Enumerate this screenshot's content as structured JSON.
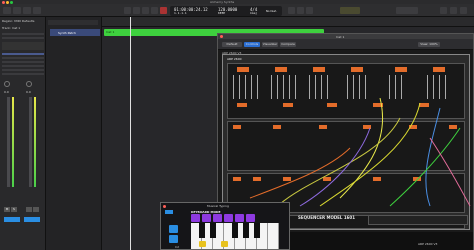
{
  "window": {
    "title": "Alchemy Synths"
  },
  "transport": {
    "position": "1.1.1.1",
    "bars": "01:00:00:24.12",
    "tempo": "120.0000",
    "tempo_label": "KEEP",
    "signature": "4/4",
    "key": "Cmaj",
    "bpm_mode": "Normal"
  },
  "inspector": {
    "region_label": "Region: MIDI Defaults",
    "track_label": "Track: Inst 1",
    "channel_strip": "Setting",
    "eq_label": "EQ",
    "plugin_slot": "Alchemy",
    "send_label": "Sends",
    "output": "Stereo Out",
    "group": "Group",
    "automation": "Read",
    "volume": "0.0",
    "volume2": "0.0",
    "mute": "M",
    "solo": "S"
  },
  "track": {
    "name": "Synth Patch",
    "region_name": "Inst 1"
  },
  "plugin": {
    "title": "Inst 1",
    "preset": "Default",
    "tab_controls": "Controls",
    "tab_view": "Visualizer",
    "compare": "Compare",
    "view_label": "View: 100%",
    "model_name": "ARP 2600 V3",
    "synth_logo": "ARP 2600",
    "sequencer_label": "SEQUENCER MODEL 1601",
    "arp_label": "ARP 2600 V3"
  },
  "keyboard": {
    "title": "Musical Typing",
    "mode": "KEYBOARD MODE",
    "octave": "C2"
  },
  "colors": {
    "region_green": "#3ed13e",
    "accent_orange": "#e36c2a",
    "pad_purple": "#8e3ae0",
    "pad_yellow": "#e8c21e",
    "pad_blue": "#2a8ee3"
  }
}
